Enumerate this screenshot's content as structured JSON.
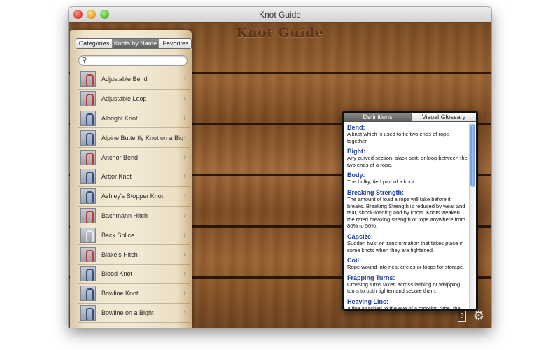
{
  "window": {
    "title": "Knot Guide"
  },
  "app": {
    "heading": "Knot Guide"
  },
  "sidebar": {
    "tabs": [
      {
        "label": "Categories"
      },
      {
        "label": "Knots by Name"
      },
      {
        "label": "Favorites"
      }
    ],
    "search": {
      "value": "",
      "placeholder": ""
    },
    "items": [
      {
        "label": "Adjustable Bend",
        "rope": "#c0392b"
      },
      {
        "label": "Adjustable Loop",
        "rope": "#c0392b"
      },
      {
        "label": "Albright Knot",
        "rope": "#2b4f86"
      },
      {
        "label": "Alpine Butterfly Knot on a Bight",
        "rope": "#2b4f86"
      },
      {
        "label": "Anchor Bend",
        "rope": "#c0392b"
      },
      {
        "label": "Arbor Knot",
        "rope": "#2b4f86"
      },
      {
        "label": "Ashley's Stopper Knot",
        "rope": "#2b4f86"
      },
      {
        "label": "Bachmann Hitch",
        "rope": "#c0392b"
      },
      {
        "label": "Back Splice",
        "rope": "#e8e8e8"
      },
      {
        "label": "Blake's Hitch",
        "rope": "#c0392b"
      },
      {
        "label": "Blood Knot",
        "rope": "#2b4f86"
      },
      {
        "label": "Bowline Knot",
        "rope": "#2b4f86"
      },
      {
        "label": "Bowline on a Bight",
        "rope": "#2b4f86"
      }
    ]
  },
  "glossary": {
    "tabs": [
      {
        "label": "Definitions"
      },
      {
        "label": "Visual Glossary"
      }
    ],
    "entries": [
      {
        "term": "Bend:",
        "definition": "A knot which is used to tie two ends of rope together."
      },
      {
        "term": "Bight:",
        "definition": "Any curved section, slack part, or loop between the two ends of a rope."
      },
      {
        "term": "Body:",
        "definition": "The bulky, tied part of a knot."
      },
      {
        "term": "Breaking Strength:",
        "definition": "The amount of load a rope will take before it breaks. Breaking Strength is reduced by wear and tear, shock-loading and by knots. Knots weaken the rated breaking strength of rope anywhere from 80% to 50%."
      },
      {
        "term": "Capsize:",
        "definition": "Sudden twist or transformation that takes place in some knots when they are tightened."
      },
      {
        "term": "Coil:",
        "definition": "Rope wound into neat circles or loops for storage."
      },
      {
        "term": "Frapping Turns:",
        "definition": "Crossing turns taken across lashing or whipping turns to both tighten and secure them."
      },
      {
        "term": "Heaving Line:",
        "definition": "A line attached to the eye of a mooring rope, the heaving line bears a heavy knot, often a weighted"
      }
    ]
  },
  "footer": {
    "help_icon": "?",
    "settings_icon": "gear-icon"
  }
}
